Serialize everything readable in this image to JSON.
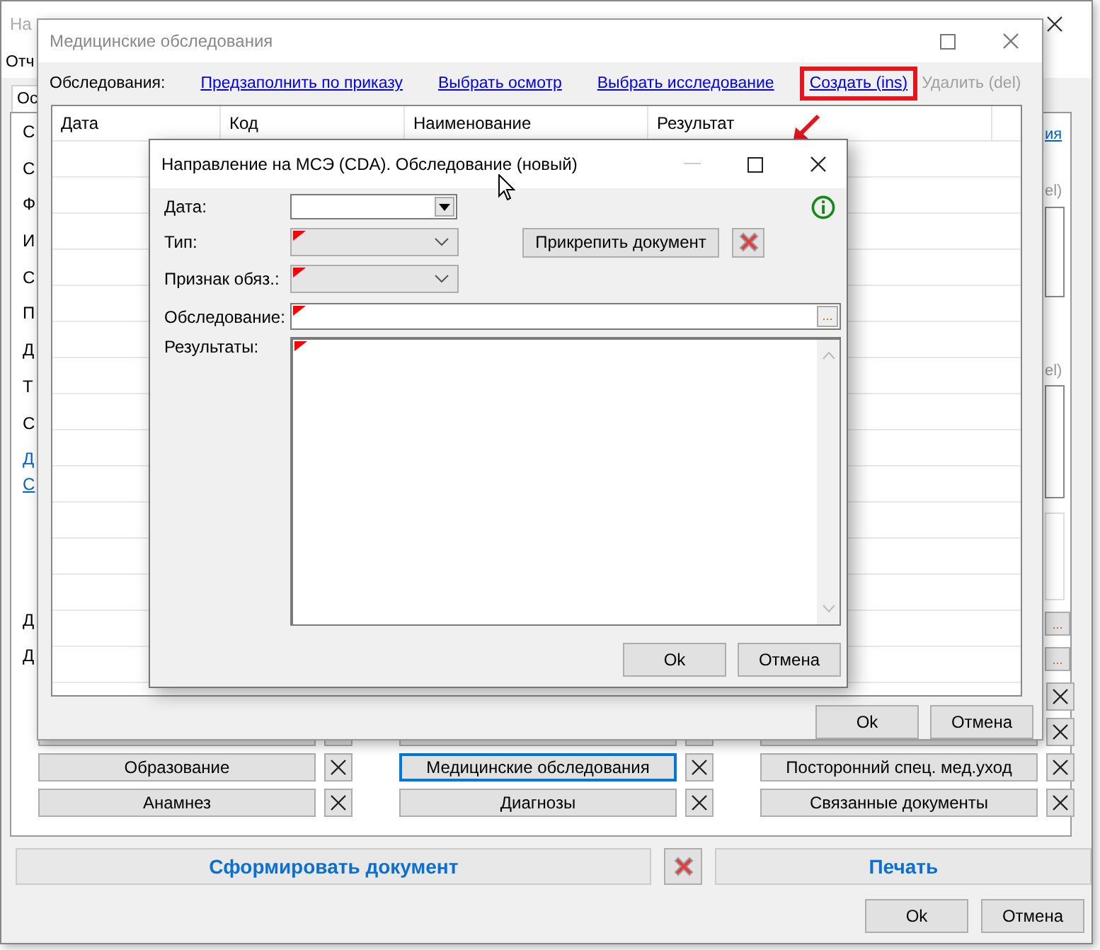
{
  "main_window": {
    "title": "На",
    "menu": [
      {
        "label": "Отч"
      }
    ],
    "tabs": [
      {
        "label": "Ос",
        "selected": true
      }
    ],
    "left_fields": [
      {
        "text": "С",
        "kind": "label"
      },
      {
        "text": "С",
        "kind": "label"
      },
      {
        "text": "Ф",
        "kind": "label"
      },
      {
        "text": "И",
        "kind": "label"
      },
      {
        "text": "С",
        "kind": "label"
      },
      {
        "text": "П",
        "kind": "label"
      },
      {
        "text": "Д",
        "kind": "label"
      },
      {
        "text": "Т",
        "kind": "label"
      },
      {
        "text": "С",
        "kind": "label"
      },
      {
        "text": "Д",
        "kind": "link"
      },
      {
        "text": "С",
        "kind": "link"
      }
    ],
    "lower_fields": [
      {
        "text": "Д",
        "kind": "label"
      },
      {
        "text": "Д",
        "kind": "label"
      }
    ],
    "right_texts": [
      {
        "text": "ия",
        "kind": "link"
      },
      {
        "text": "el)",
        "kind": "disabled"
      },
      {
        "text": "el)",
        "kind": "disabled"
      }
    ],
    "browse_buttons": [
      "...",
      "..."
    ],
    "section_buttons": [
      {
        "label": "Образование",
        "focused": false
      },
      {
        "label": "Медицинские обследования",
        "focused": true
      },
      {
        "label": "Посторонний спец. мед.уход",
        "focused": false
      },
      {
        "label": "Анамнез",
        "focused": false
      },
      {
        "label": "Диагнозы",
        "focused": false
      },
      {
        "label": "Связанные документы",
        "focused": false
      }
    ],
    "generate_button": "Сформировать документ",
    "print_button": "Печать",
    "ok": "Ok",
    "cancel": "Отмена"
  },
  "exams_window": {
    "title": "Медицинские обследования",
    "toolbar_label": "Обследования:",
    "actions": [
      {
        "label": "Предзаполнить по приказу",
        "disabled": false,
        "highlighted": false
      },
      {
        "label": "Выбрать осмотр",
        "disabled": false,
        "highlighted": false
      },
      {
        "label": "Выбрать исследование",
        "disabled": false,
        "highlighted": false
      },
      {
        "label": "Создать (ins)",
        "disabled": false,
        "highlighted": true
      },
      {
        "label": "Удалить (del)",
        "disabled": true,
        "highlighted": false
      }
    ],
    "table": {
      "columns": [
        "Дата",
        "Код",
        "Наименование",
        "Результат"
      ]
    },
    "ok": "Ok",
    "cancel": "Отмена"
  },
  "dialog": {
    "title": "Направление на МСЭ (CDA). Обследование (новый)",
    "fields": [
      {
        "label": "Дата:",
        "kind": "date",
        "required": false,
        "disabled": false
      },
      {
        "label": "Тип:",
        "kind": "combo",
        "required": true,
        "disabled": true
      },
      {
        "label": "Признак обяз.:",
        "kind": "combo",
        "required": true,
        "disabled": true
      },
      {
        "label": "Обследование:",
        "kind": "lookup",
        "required": true,
        "disabled": false
      },
      {
        "label": "Результаты:",
        "kind": "memo",
        "required": true,
        "disabled": false
      }
    ],
    "attach_button": "Прикрепить документ",
    "browse_button": "...",
    "ok": "Ok",
    "cancel": "Отмена"
  }
}
